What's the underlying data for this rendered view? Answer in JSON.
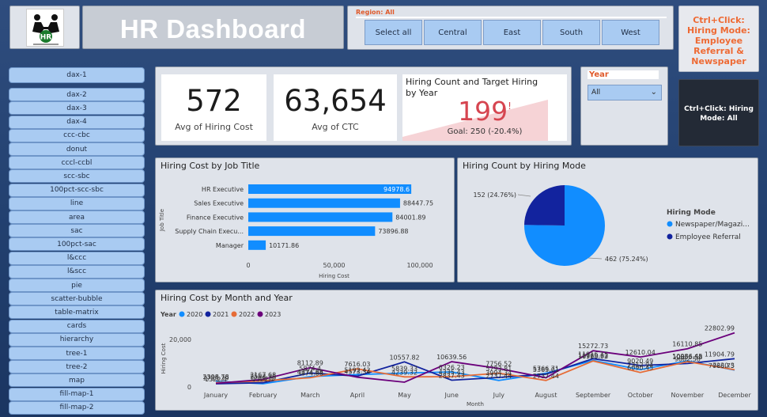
{
  "header": {
    "logo_text": "HR",
    "title": "HR Dashboard"
  },
  "region_filter": {
    "label": "Region: All",
    "options": [
      "Select all",
      "Central",
      "East",
      "South",
      "West"
    ]
  },
  "tips": {
    "hiring_mode_tip": "Ctrl+Click: Hiring Mode: Employee Referral & Newspaper",
    "all_tip": "Ctrl+Click: Hiring Mode: All"
  },
  "sidebar": {
    "items": [
      "dax-1",
      "dax-2",
      "dax-3",
      "dax-4",
      "ccc-cbc",
      "donut",
      "cccl-ccbl",
      "scc-sbc",
      "100pct-scc-sbc",
      "line",
      "area",
      "sac",
      "100pct-sac",
      "l&ccc",
      "l&scc",
      "pie",
      "scatter-bubble",
      "table-matrix",
      "cards",
      "hierarchy",
      "tree-1",
      "tree-2",
      "map",
      "fill-map-1",
      "fill-map-2"
    ]
  },
  "kpis": {
    "avg_hiring_cost": {
      "value": "572",
      "label": "Avg of Hiring Cost"
    },
    "avg_ctc": {
      "value": "63,654",
      "label": "Avg of CTC"
    },
    "target": {
      "title": "Hiring Count and Target Hiring by Year",
      "value": "199",
      "marker": "!",
      "goal": "Goal: 250 (-20.4%)"
    }
  },
  "year_filter": {
    "label": "Year",
    "selected": "All"
  },
  "colors": {
    "accent_blue": "#118DFF",
    "dark_blue": "#12239E",
    "orange": "#E66C37",
    "purple": "#6B007B",
    "kpi_red": "#D64550"
  },
  "chart_data": [
    {
      "type": "bar",
      "title": "Hiring Cost by Job Title",
      "xlabel": "Hiring Cost",
      "ylabel": "Job Title",
      "categories": [
        "HR Executive",
        "Sales Executive",
        "Finance Executive",
        "Supply Chain Execu...",
        "Manager"
      ],
      "values": [
        94978.6,
        88447.75,
        84001.89,
        73896.88,
        10171.86
      ],
      "value_labels": [
        "94978.6",
        "88447.75",
        "84001.89",
        "73896.88",
        "10171.86"
      ],
      "xlim": [
        0,
        100000
      ],
      "xticks": [
        0,
        50000,
        100000
      ],
      "xtick_labels": [
        "0",
        "50,000",
        "100,000"
      ],
      "color": "#118DFF"
    },
    {
      "type": "pie",
      "title": "Hiring Count by Hiring Mode",
      "legend_title": "Hiring Mode",
      "legend_placement": "right",
      "slices": [
        {
          "name": "Newspaper/Magazi...",
          "value": 462,
          "label": "462 (75.24%)",
          "color": "#118DFF"
        },
        {
          "name": "Employee Referral",
          "value": 152,
          "label": "152 (24.76%)",
          "color": "#12239E"
        }
      ]
    },
    {
      "type": "line",
      "title": "Hiring Cost by Month and Year",
      "legend_title": "Year",
      "legend_placement": "top-left",
      "xlabel": "Month",
      "ylabel": "Hiring Cost",
      "categories": [
        "January",
        "February",
        "March",
        "April",
        "May",
        "June",
        "July",
        "August",
        "September",
        "October",
        "November",
        "December"
      ],
      "yticks": [
        0,
        20000
      ],
      "ytick_labels": [
        "0",
        "20,000"
      ],
      "ylim": [
        0,
        24000
      ],
      "series": [
        {
          "name": "2020",
          "color": "#118DFF",
          "values": [
            2398.78,
            1322.4,
            4374.88,
            5192.42,
            5839.33,
            6326.23,
            2737.44,
            5766.71,
            11169.03,
            7312.94,
            10986.45,
            7066.75
          ],
          "labels": [
            "2398.78",
            "1322.4",
            "4374.88",
            "5192.42",
            "5839.33",
            "6326.23",
            "2737.44",
            "5766.71",
            "11169.03",
            "7312.94",
            "10986.45",
            "7066.75"
          ]
        },
        {
          "name": "2021",
          "color": "#12239E",
          "values": [
            1322.4,
            1755.29,
            5874.4,
            4573.34,
            10557.82,
            2837.43,
            3994.34,
            5363.01,
            11916.15,
            9020.49,
            9882.58,
            11904.79
          ],
          "labels": [
            "1322.4",
            "1755.29",
            "5874.4",
            "4573.34",
            "10557.82",
            "2837.43",
            "3994.34",
            "5363.01",
            "11916.15",
            "9020.49",
            "9882.58",
            "11904.79"
          ]
        },
        {
          "name": "2022",
          "color": "#E66C37",
          "values": [
            1755.29,
            2553.79,
            3874.88,
            7616.03,
            4239.32,
            4335.43,
            5793.81,
            2737.44,
            10928.52,
            6090.45,
            10655.58,
            7230.3
          ],
          "labels": [
            "1755.29",
            "2553.79",
            "3874.88",
            "7616.03",
            "4239.32",
            "4335.43",
            "5793.81",
            "2737.44",
            "10928.52",
            "6090.45",
            "10655.58",
            "7230.3"
          ]
        },
        {
          "name": "2023",
          "color": "#6B007B",
          "values": [
            1500.3,
            3167.68,
            8112.89,
            4114.01,
            2000.08,
            10639.56,
            7756.52,
            3870.21,
            15272.73,
            12610.04,
            16110.85,
            22802.99
          ],
          "labels": [
            "",
            "3167.68",
            "8112.89",
            "",
            "",
            "10639.56",
            "7756.52",
            "",
            "15272.73",
            "12610.04",
            "16110.85",
            "22802.99"
          ]
        }
      ]
    }
  ]
}
